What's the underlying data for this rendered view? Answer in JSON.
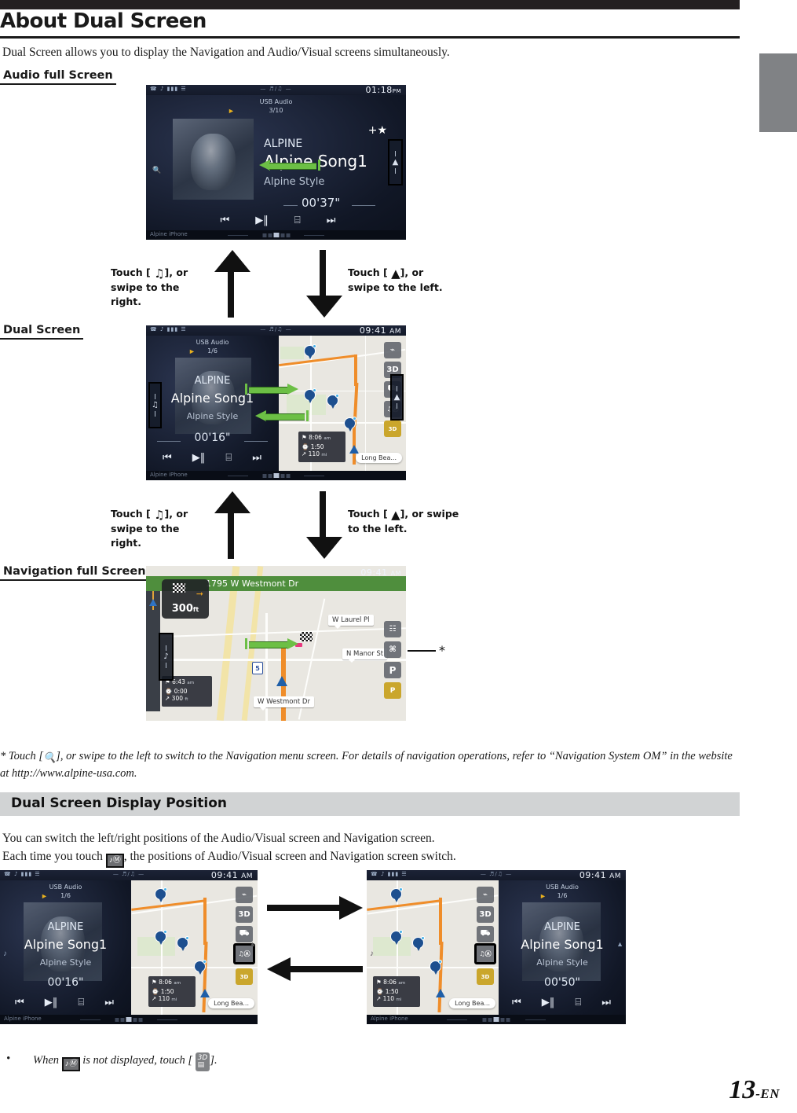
{
  "page": {
    "title": "About Dual Screen",
    "intro": "Dual Screen allows you to display the Navigation and Audio/Visual screens simultaneously.",
    "page_number": "13",
    "page_suffix": "-EN"
  },
  "labels": {
    "audio_full_screen": "Audio full Screen",
    "dual_screen": "Dual Screen",
    "navigation_full_screen": "Navigation full Screen"
  },
  "touch_notes": {
    "a_left": "Touch [ ♫ ], or swipe to the right.",
    "a_left_pre": "Touch [",
    "a_left_post": "], or swipe to the right.",
    "a_right_post": "], or swipe to the left.",
    "b_right_post": "], or swipe to the left.",
    "note_up_1": "Touch [ ], or swipe to the right.",
    "note_down_1": "Touch [ ], or swipe to the left.",
    "note_up_2": "Touch [ ], or swipe to the right.",
    "note_down_2": "Touch [ ], or swipe to the left."
  },
  "footnote": {
    "marker": "*",
    "text_a": "Touch [",
    "text_b": "], or swipe to the left to switch to the Navigation menu screen. For details of navigation operations, refer to “Navigation System OM” in the website at http://www.alpine-usa.com."
  },
  "section": {
    "heading": "Dual Screen Display Position",
    "para1": "You can switch the left/right positions of the Audio/Visual screen and Navigation screen.",
    "para2_a": "Each time you touch",
    "para2_b": ", the positions of Audio/Visual screen and Navigation screen switch.",
    "bullet_a": "When",
    "bullet_b": "is not displayed, touch [",
    "bullet_c": "]."
  },
  "screens": {
    "audio_full": {
      "clock": "01:18",
      "meridiem": "PM",
      "source": "USB Audio",
      "track": "3/10",
      "artist": "ALPINE",
      "title": "Alpine Song1",
      "style": "Alpine Style",
      "elapsed": "00'37\"",
      "device": "Alpine iPhone",
      "favorite": "+★",
      "controls": [
        "⏮",
        "▶‖",
        "⌸",
        "⏭"
      ]
    },
    "dual": {
      "clock": "09:41",
      "meridiem": "AM",
      "source": "USB Audio",
      "track": "1/6",
      "artist": "ALPINE",
      "title": "Alpine Song1",
      "style": "Alpine Style",
      "elapsed": "00'16\"",
      "device": "Alpine iPhone",
      "map_buttons": [
        "⌁",
        "3D",
        "⛟",
        "♫Ⓐ",
        "3D"
      ],
      "eta": "8:06",
      "eta_unit": "am",
      "duration": "1:50",
      "distance": "110",
      "distance_unit": "mi",
      "destination": "Long Bea..."
    },
    "nav_full": {
      "clock": "09:41",
      "meridiem": "AM",
      "banner_street": "1795 W Westmont Dr",
      "turn_distance": "300",
      "turn_unit": "ft",
      "eta": "6:43",
      "eta_unit": "am",
      "duration": "0:00",
      "distance": "300",
      "distance_unit": "ft",
      "street_labels": [
        "W Laurel Pl",
        "N Manor St",
        "W Westmont Dr"
      ],
      "highway_shield": "5",
      "map_buttons": [
        "☷",
        "⌘",
        "P",
        "P"
      ]
    },
    "swap_left": {
      "clock": "09:41",
      "meridiem": "AM",
      "source": "USB Audio",
      "track": "1/6",
      "artist": "ALPINE",
      "title": "Alpine Song1",
      "style": "Alpine Style",
      "elapsed": "00'16\"",
      "device": "Alpine iPhone",
      "eta": "8:06",
      "eta_unit": "am",
      "duration": "1:50",
      "distance": "110",
      "distance_unit": "mi",
      "destination": "Long Bea..."
    },
    "swap_right": {
      "clock": "09:41",
      "meridiem": "AM",
      "source": "USB Audio",
      "track": "1/6",
      "artist": "ALPINE",
      "title": "Alpine Song1",
      "style": "Alpine Style",
      "elapsed": "00'50\"",
      "device": "Alpine iPhone",
      "eta": "8:06",
      "eta_unit": "am",
      "duration": "1:50",
      "distance": "110",
      "distance_unit": "mi",
      "destination": "Long Bea..."
    }
  },
  "colors": {
    "accent_green": "#6cbf45",
    "section_bar": "#d1d3d4",
    "header_black": "#231f20",
    "map_route": "#ef8d2a",
    "nav_banner": "#4f8e3d"
  }
}
